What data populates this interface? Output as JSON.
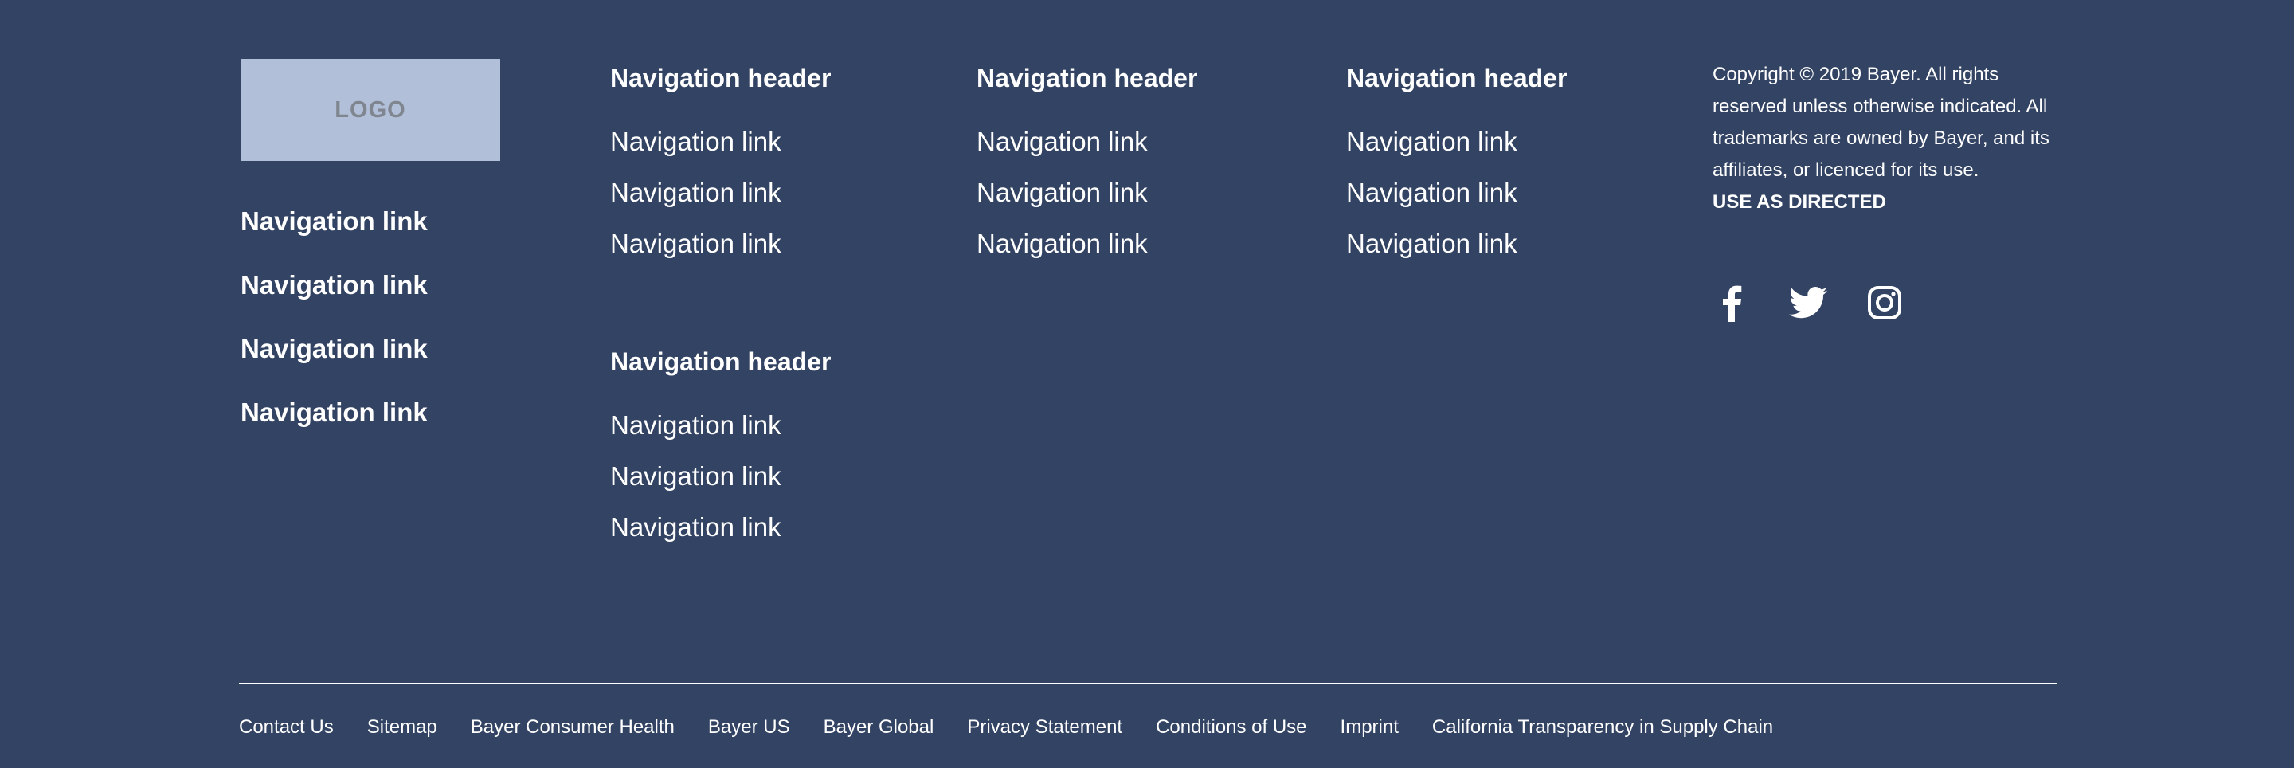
{
  "logo": {
    "text": "LOGO"
  },
  "left_links": [
    "Navigation link",
    "Navigation link",
    "Navigation link",
    "Navigation link"
  ],
  "nav_columns": [
    {
      "header": "Navigation header",
      "links": [
        "Navigation link",
        "Navigation link",
        "Navigation link"
      ]
    },
    {
      "header": "Navigation header",
      "links": [
        "Navigation link",
        "Navigation link",
        "Navigation link"
      ]
    },
    {
      "header": "Navigation header",
      "links": [
        "Navigation link",
        "Navigation link",
        "Navigation link"
      ]
    },
    {
      "header": "Navigation header",
      "links": [
        "Navigation link",
        "Navigation link",
        "Navigation link"
      ]
    }
  ],
  "info": {
    "copyright": "Copyright © 2019 Bayer. All rights reserved unless otherwise indicated. All trademarks are owned by Bayer, and its affiliates, or licenced for its use.",
    "use_as_directed": "USE AS DIRECTED"
  },
  "social": [
    {
      "icon": "facebook-icon"
    },
    {
      "icon": "twitter-icon"
    },
    {
      "icon": "instagram-icon"
    }
  ],
  "bottom_links": [
    "Contact Us",
    "Sitemap",
    "Bayer Consumer Health",
    "Bayer US",
    "Bayer Global",
    "Privacy Statement",
    "Conditions of Use",
    "Imprint",
    "California Transparency in Supply Chain"
  ],
  "colors": {
    "background": "#334363",
    "logo_bg": "#b1bfd8",
    "logo_text": "#7f8690",
    "text": "#ffffff"
  }
}
